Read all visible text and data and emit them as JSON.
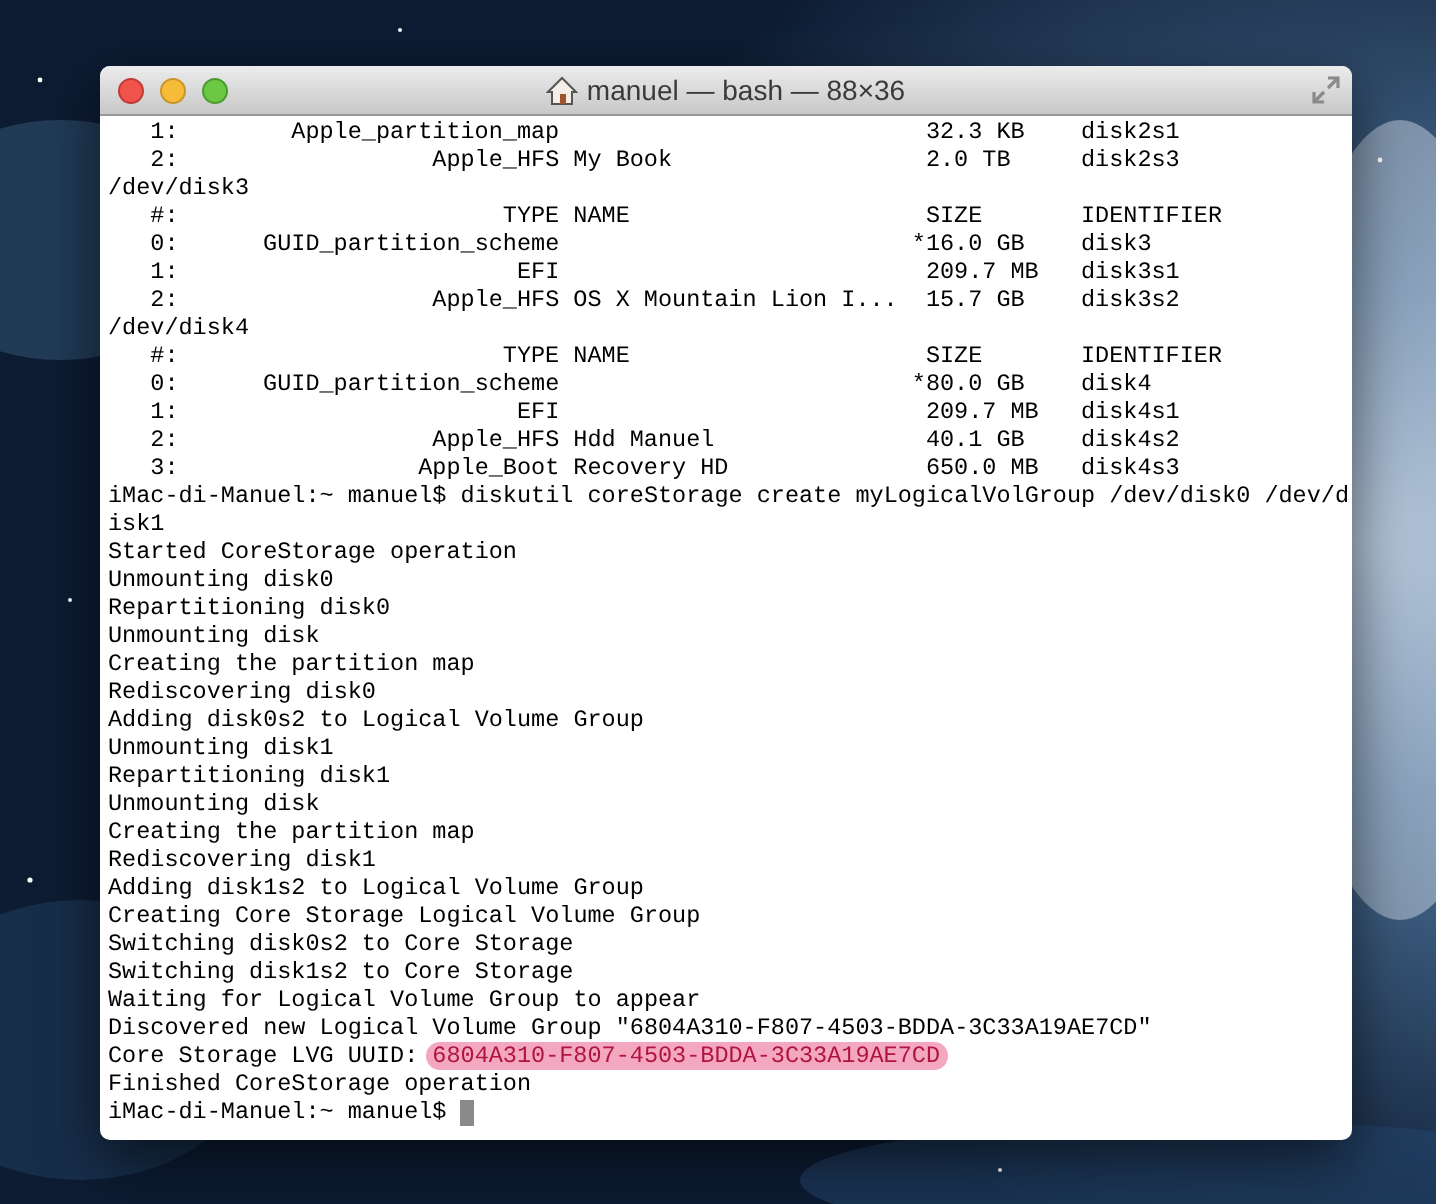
{
  "window": {
    "title": "manuel — bash — 88×36"
  },
  "terminal": {
    "lines": [
      {
        "kind": "partition",
        "index": "1:",
        "type": "Apple_partition_map",
        "size": "32.3 KB",
        "identifier": "disk2s1"
      },
      {
        "kind": "partition",
        "index": "2:",
        "type": "Apple_HFS",
        "name": "My Book",
        "size": "2.0 TB",
        "identifier": "disk2s3"
      },
      {
        "kind": "text",
        "text": "/dev/disk3"
      },
      {
        "kind": "header",
        "index": "#:",
        "type": "TYPE",
        "name": "NAME",
        "size": "SIZE",
        "identifier": "IDENTIFIER"
      },
      {
        "kind": "partition",
        "index": "0:",
        "type": "GUID_partition_scheme",
        "size": "*16.0 GB",
        "whole_disk": true,
        "identifier": "disk3"
      },
      {
        "kind": "partition",
        "index": "1:",
        "type": "EFI",
        "size": "209.7 MB",
        "identifier": "disk3s1"
      },
      {
        "kind": "partition",
        "index": "2:",
        "type": "Apple_HFS",
        "name": "OS X Mountain Lion I...",
        "size": "15.7 GB",
        "identifier": "disk3s2"
      },
      {
        "kind": "text",
        "text": "/dev/disk4"
      },
      {
        "kind": "header",
        "index": "#:",
        "type": "TYPE",
        "name": "NAME",
        "size": "SIZE",
        "identifier": "IDENTIFIER"
      },
      {
        "kind": "partition",
        "index": "0:",
        "type": "GUID_partition_scheme",
        "size": "*80.0 GB",
        "whole_disk": true,
        "identifier": "disk4"
      },
      {
        "kind": "partition",
        "index": "1:",
        "type": "EFI",
        "size": "209.7 MB",
        "identifier": "disk4s1"
      },
      {
        "kind": "partition",
        "index": "2:",
        "type": "Apple_HFS",
        "name": "Hdd Manuel",
        "size": "40.1 GB",
        "identifier": "disk4s2"
      },
      {
        "kind": "partition",
        "index": "3:",
        "type": "Apple_Boot",
        "name": "Recovery HD",
        "size": "650.0 MB",
        "identifier": "disk4s3"
      },
      {
        "kind": "text",
        "text": "iMac-di-Manuel:~ manuel$ diskutil coreStorage create myLogicalVolGroup /dev/disk0 /dev/d"
      },
      {
        "kind": "text",
        "text": "isk1"
      },
      {
        "kind": "text",
        "text": "Started CoreStorage operation"
      },
      {
        "kind": "text",
        "text": "Unmounting disk0"
      },
      {
        "kind": "text",
        "text": "Repartitioning disk0"
      },
      {
        "kind": "text",
        "text": "Unmounting disk"
      },
      {
        "kind": "text",
        "text": "Creating the partition map"
      },
      {
        "kind": "text",
        "text": "Rediscovering disk0"
      },
      {
        "kind": "text",
        "text": "Adding disk0s2 to Logical Volume Group"
      },
      {
        "kind": "text",
        "text": "Unmounting disk1"
      },
      {
        "kind": "text",
        "text": "Repartitioning disk1"
      },
      {
        "kind": "text",
        "text": "Unmounting disk"
      },
      {
        "kind": "text",
        "text": "Creating the partition map"
      },
      {
        "kind": "text",
        "text": "Rediscovering disk1"
      },
      {
        "kind": "text",
        "text": "Adding disk1s2 to Logical Volume Group"
      },
      {
        "kind": "text",
        "text": "Creating Core Storage Logical Volume Group"
      },
      {
        "kind": "text",
        "text": "Switching disk0s2 to Core Storage"
      },
      {
        "kind": "text",
        "text": "Switching disk1s2 to Core Storage"
      },
      {
        "kind": "text",
        "text": "Waiting for Logical Volume Group to appear"
      },
      {
        "kind": "text",
        "text": "Discovered new Logical Volume Group \"6804A310-F807-4503-BDDA-3C33A19AE7CD\""
      },
      {
        "kind": "highlighted",
        "text": "Core Storage LVG UUID:",
        "highlight": "6804A310-F807-4503-BDDA-3C33A19AE7CD"
      },
      {
        "kind": "text",
        "text": "Finished CoreStorage operation"
      },
      {
        "kind": "prompt",
        "text": "iMac-di-Manuel:~ manuel$"
      }
    ]
  }
}
